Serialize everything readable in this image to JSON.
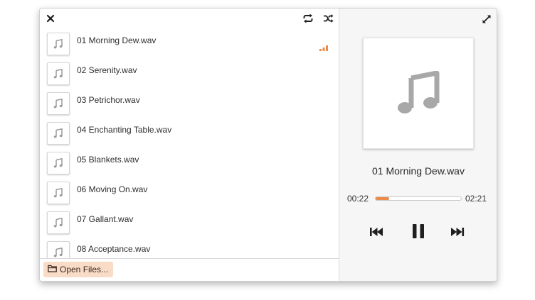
{
  "header": {
    "close_icon": "close-icon",
    "repeat_icon": "repeat-icon",
    "shuffle_icon": "shuffle-icon",
    "expand_icon": "expand-icon"
  },
  "playlist": {
    "tracks": [
      {
        "title": "01 Morning Dew.wav",
        "playing": true
      },
      {
        "title": "02 Serenity.wav"
      },
      {
        "title": "03 Petrichor.wav"
      },
      {
        "title": "04 Enchanting Table.wav"
      },
      {
        "title": "05 Blankets.wav"
      },
      {
        "title": "06 Moving On.wav"
      },
      {
        "title": "07 Gallant.wav"
      },
      {
        "title": "08 Acceptance.wav"
      }
    ]
  },
  "footer": {
    "open_files_label": "Open Files...",
    "folder_icon": "folder-icon"
  },
  "now_playing": {
    "title": "01 Morning Dew.wav",
    "current_time": "00:22",
    "duration": "02:21",
    "progress": 0.156,
    "cover_icon": "music-note-icon"
  },
  "controls": {
    "prev_icon": "skip-back-icon",
    "pause_icon": "pause-icon",
    "next_icon": "skip-forward-icon"
  },
  "colors": {
    "accent": "#ec8a4c",
    "open_button_bg": "#f8dcc8",
    "panel_bg": "#f6f6f6"
  }
}
